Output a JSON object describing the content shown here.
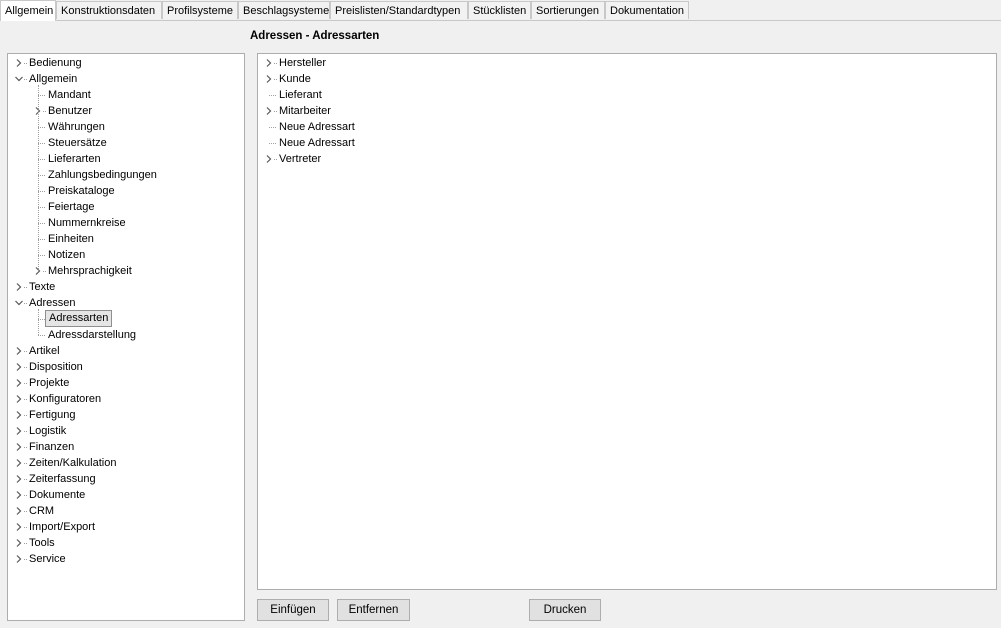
{
  "tabs": [
    {
      "label": "Allgemein",
      "active": true
    },
    {
      "label": "Konstruktionsdaten",
      "active": false
    },
    {
      "label": "Profilsysteme",
      "active": false
    },
    {
      "label": "Beschlagsysteme",
      "active": false
    },
    {
      "label": "Preislisten/Standardtypen",
      "active": false
    },
    {
      "label": "Stücklisten",
      "active": false
    },
    {
      "label": "Sortierungen",
      "active": false
    },
    {
      "label": "Dokumentation",
      "active": false
    }
  ],
  "section_title": "Adressen - Adressarten",
  "left_tree": [
    {
      "label": "Bedienung",
      "level": 0,
      "state": "collapsed"
    },
    {
      "label": "Allgemein",
      "level": 0,
      "state": "expanded"
    },
    {
      "label": "Mandant",
      "level": 1,
      "state": "leaf"
    },
    {
      "label": "Benutzer",
      "level": 1,
      "state": "collapsed"
    },
    {
      "label": "Währungen",
      "level": 1,
      "state": "leaf"
    },
    {
      "label": "Steuersätze",
      "level": 1,
      "state": "leaf"
    },
    {
      "label": "Lieferarten",
      "level": 1,
      "state": "leaf"
    },
    {
      "label": "Zahlungsbedingungen",
      "level": 1,
      "state": "leaf"
    },
    {
      "label": "Preiskataloge",
      "level": 1,
      "state": "leaf"
    },
    {
      "label": "Feiertage",
      "level": 1,
      "state": "leaf"
    },
    {
      "label": "Nummernkreise",
      "level": 1,
      "state": "leaf"
    },
    {
      "label": "Einheiten",
      "level": 1,
      "state": "leaf"
    },
    {
      "label": "Notizen",
      "level": 1,
      "state": "leaf"
    },
    {
      "label": "Mehrsprachigkeit",
      "level": 1,
      "state": "collapsed"
    },
    {
      "label": "Texte",
      "level": 0,
      "state": "collapsed"
    },
    {
      "label": "Adressen",
      "level": 0,
      "state": "expanded"
    },
    {
      "label": "Adressarten",
      "level": 1,
      "state": "leaf",
      "selected": true
    },
    {
      "label": "Adressdarstellung",
      "level": 1,
      "state": "leaf"
    },
    {
      "label": "Artikel",
      "level": 0,
      "state": "collapsed"
    },
    {
      "label": "Disposition",
      "level": 0,
      "state": "collapsed"
    },
    {
      "label": "Projekte",
      "level": 0,
      "state": "collapsed"
    },
    {
      "label": "Konfiguratoren",
      "level": 0,
      "state": "collapsed"
    },
    {
      "label": "Fertigung",
      "level": 0,
      "state": "collapsed"
    },
    {
      "label": "Logistik",
      "level": 0,
      "state": "collapsed"
    },
    {
      "label": "Finanzen",
      "level": 0,
      "state": "collapsed"
    },
    {
      "label": "Zeiten/Kalkulation",
      "level": 0,
      "state": "collapsed"
    },
    {
      "label": "Zeiterfassung",
      "level": 0,
      "state": "collapsed"
    },
    {
      "label": "Dokumente",
      "level": 0,
      "state": "collapsed"
    },
    {
      "label": "CRM",
      "level": 0,
      "state": "collapsed"
    },
    {
      "label": "Import/Export",
      "level": 0,
      "state": "collapsed"
    },
    {
      "label": "Tools",
      "level": 0,
      "state": "collapsed"
    },
    {
      "label": "Service",
      "level": 0,
      "state": "collapsed"
    }
  ],
  "right_tree": [
    {
      "label": "Hersteller",
      "state": "collapsed"
    },
    {
      "label": "Kunde",
      "state": "collapsed"
    },
    {
      "label": "Lieferant",
      "state": "leaf"
    },
    {
      "label": "Mitarbeiter",
      "state": "collapsed"
    },
    {
      "label": "Neue Adressart",
      "state": "leaf"
    },
    {
      "label": "Neue Adressart",
      "state": "leaf"
    },
    {
      "label": "Vertreter",
      "state": "collapsed"
    }
  ],
  "buttons": {
    "insert": "Einfügen",
    "remove": "Entfernen",
    "print": "Drucken"
  },
  "colors": {
    "window_bg": "#f0f0f0",
    "panel_bg": "#ffffff",
    "border": "#adadad",
    "selection_bg": "#e5e5e5",
    "button_bg": "#e1e1e1"
  },
  "icons": {
    "collapsed": "chevron-right-icon",
    "expanded": "chevron-down-icon"
  }
}
